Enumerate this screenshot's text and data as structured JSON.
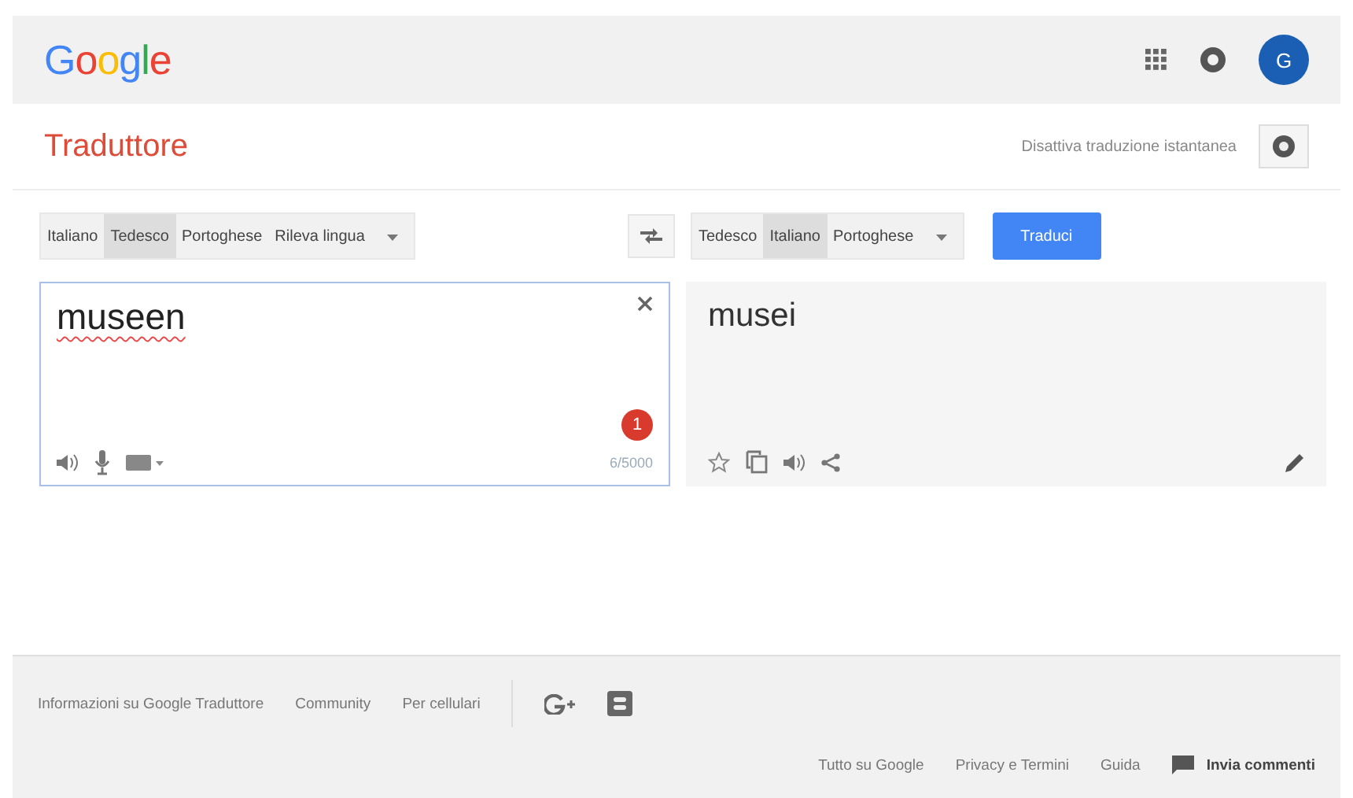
{
  "header": {
    "logo": "Google",
    "avatar": "G"
  },
  "subheader": {
    "title": "Traduttore",
    "instant_toggle": "Disattiva traduzione istantanea"
  },
  "source_languages": [
    {
      "label": "Italiano",
      "selected": false
    },
    {
      "label": "Tedesco",
      "selected": true
    },
    {
      "label": "Portoghese",
      "selected": false
    },
    {
      "label": "Rileva lingua",
      "selected": false
    }
  ],
  "target_languages": [
    {
      "label": "Tedesco",
      "selected": false
    },
    {
      "label": "Italiano",
      "selected": true
    },
    {
      "label": "Portoghese",
      "selected": false
    }
  ],
  "translate_button": "Traduci",
  "source": {
    "value": "museen",
    "badge": "1",
    "char_count": "6/5000"
  },
  "result": {
    "text": "musei"
  },
  "footer": {
    "links": [
      "Informazioni su Google Traduttore",
      "Community",
      "Per cellulari"
    ],
    "bottom_links": [
      "Tutto su Google",
      "Privacy e Termini",
      "Guida"
    ],
    "feedback": "Invia commenti"
  }
}
